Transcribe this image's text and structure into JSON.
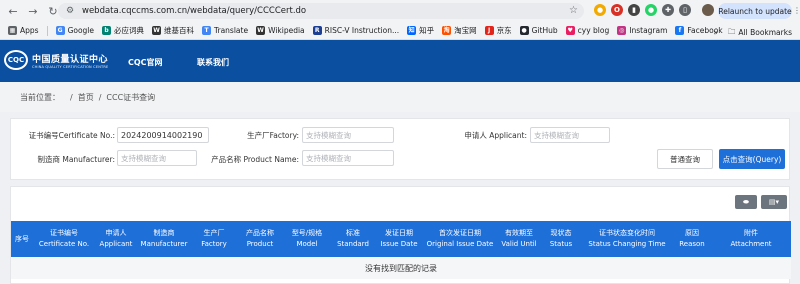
{
  "browser": {
    "url": "webdata.cqccms.com.cn/webdata/query/CCCCert.do",
    "relaunch_label": "Relaunch to update",
    "bookmarks": [
      {
        "label": "Apps",
        "icon": "apps-grid-icon",
        "color": "#5f6368"
      },
      {
        "label": "Google",
        "icon": "google-icon",
        "color": "#4285f4"
      },
      {
        "label": "必应词典",
        "icon": "bing-icon",
        "color": "#008373"
      },
      {
        "label": "维基百科",
        "icon": "wikipedia-icon",
        "color": "#333333"
      },
      {
        "label": "Translate",
        "icon": "translate-icon",
        "color": "#4285f4"
      },
      {
        "label": "Wikipedia",
        "icon": "wikipedia-icon",
        "color": "#333333"
      },
      {
        "label": "RISC-V Instruction...",
        "icon": "riscv-icon",
        "color": "#1c3f94"
      },
      {
        "label": "知乎",
        "icon": "zhihu-icon",
        "color": "#0066ff"
      },
      {
        "label": "淘宝网",
        "icon": "taobao-icon",
        "color": "#ff5000"
      },
      {
        "label": "京东",
        "icon": "jd-icon",
        "color": "#e1251b"
      },
      {
        "label": "GitHub",
        "icon": "github-icon",
        "color": "#24292f"
      },
      {
        "label": "cyy blog",
        "icon": "heart-icon",
        "color": "#e91e63"
      },
      {
        "label": "Instagram",
        "icon": "instagram-icon",
        "color": "#c13584"
      },
      {
        "label": "Facebook",
        "icon": "facebook-icon",
        "color": "#1877f2"
      }
    ],
    "more": "»",
    "all_bookmarks": "All Bookmarks"
  },
  "site": {
    "logo_mark": "CQC",
    "logo_cn": "中国质量认证中心",
    "logo_en": "CHINA QUALITY CERTIFICATION CENTRE",
    "nav": [
      "CQC官网",
      "联系我们"
    ],
    "header_color": "#0a4fa0"
  },
  "breadcrumb": {
    "prefix": "当前位置：",
    "sep1": "/",
    "home": "首页",
    "sep2": "/",
    "current": "CCC证书查询"
  },
  "form": {
    "cert_no_label": "证书编号Certificate No.:",
    "cert_no_value": "2024200914002190",
    "factory_label": "生产厂Factory:",
    "factory_placeholder": "支持模糊查询",
    "applicant_label": "申请人 Applicant:",
    "applicant_placeholder": "支持模糊查询",
    "manufacturer_label": "制造商 Manufacturer:",
    "manufacturer_placeholder": "支持模糊查询",
    "product_label": "产品名称 Product Name:",
    "product_placeholder": "支持模糊查询",
    "normal_query": "普通查询",
    "query": "点击查询(Query)",
    "primary_color": "#1f6fd9"
  },
  "table": {
    "columns": [
      {
        "cn": "序号",
        "en": ""
      },
      {
        "cn": "证书编号",
        "en": "Certificate No."
      },
      {
        "cn": "申请人",
        "en": "Applicant"
      },
      {
        "cn": "制造商",
        "en": "Manufacturer"
      },
      {
        "cn": "生产厂",
        "en": "Factory"
      },
      {
        "cn": "产品名称",
        "en": "Product"
      },
      {
        "cn": "型号/规格",
        "en": "Model"
      },
      {
        "cn": "标准",
        "en": "Standard"
      },
      {
        "cn": "发证日期",
        "en": "Issue Date"
      },
      {
        "cn": "首次发证日期",
        "en": "Original Issue Date"
      },
      {
        "cn": "有效期至",
        "en": "Valid Until"
      },
      {
        "cn": "现状态",
        "en": "Status"
      },
      {
        "cn": "证书状态变化时间",
        "en": "Status Changing Time"
      },
      {
        "cn": "原因",
        "en": "Reason"
      },
      {
        "cn": "附件",
        "en": "Attachment"
      }
    ],
    "empty_text": "没有找到匹配的记录"
  }
}
